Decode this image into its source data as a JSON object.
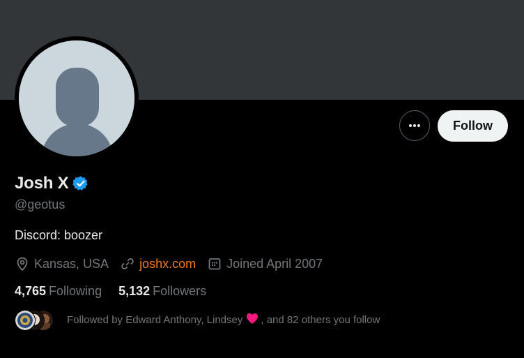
{
  "profile": {
    "display_name": "Josh X",
    "handle": "@geotus",
    "bio": "Discord: boozer",
    "location": "Kansas, USA",
    "website": "joshx.com",
    "joined": "Joined April 2007",
    "following_count": "4,765",
    "following_label": "Following",
    "followers_count": "5,132",
    "followers_label": "Followers"
  },
  "actions": {
    "follow_label": "Follow"
  },
  "followed_by": {
    "prefix": "Followed by Edward Anthony, Lindsey",
    "suffix": ", and 82 others you follow"
  },
  "icons": {
    "more": "more-horizontal-icon",
    "verified": "verified-badge-icon",
    "location": "location-pin-icon",
    "link": "link-icon",
    "calendar": "calendar-icon",
    "heart": "heart-icon"
  },
  "colors": {
    "background": "#000000",
    "banner": "#333639",
    "avatar_placeholder": "#ccd6dd",
    "verified_blue": "#1d9bf0",
    "link_orange": "#f4791f",
    "secondary_text": "#71767b",
    "heart_red": "#f91880"
  }
}
